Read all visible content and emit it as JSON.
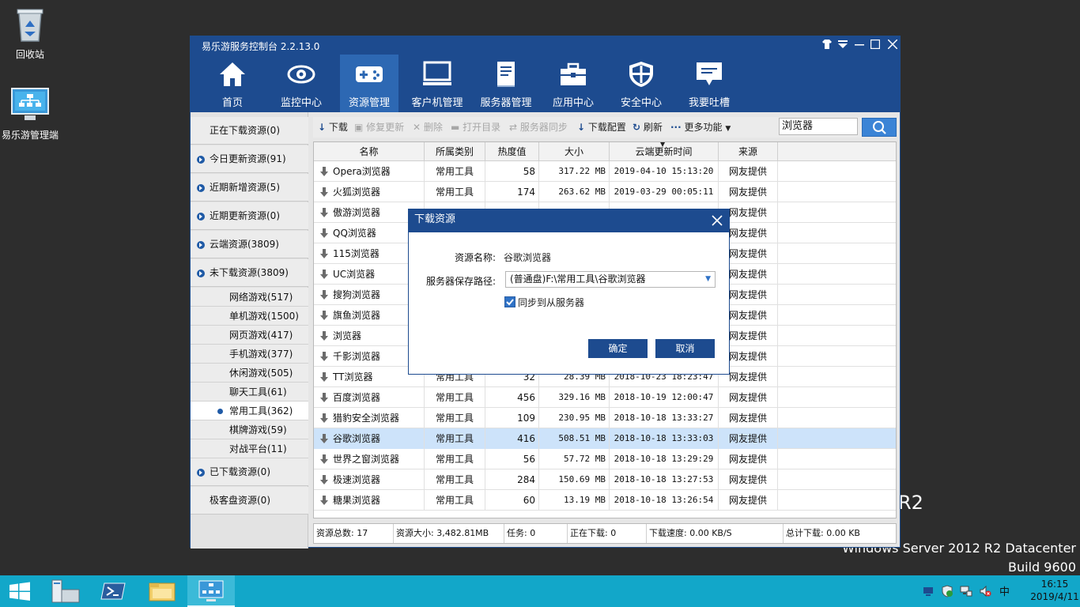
{
  "desktop": {
    "recycle_bin_label": "回收站",
    "app_icon_label": "易乐游管理端",
    "watermark_big": "R2",
    "watermark_line1": "Windows Server 2012 R2 Datacenter",
    "watermark_line2": "Build 9600"
  },
  "window": {
    "title": "易乐游服务控制台 2.2.13.0",
    "nav": [
      {
        "label": "首页",
        "icon": "home-icon"
      },
      {
        "label": "监控中心",
        "icon": "eye-icon"
      },
      {
        "label": "资源管理",
        "icon": "gamepad-icon"
      },
      {
        "label": "客户机管理",
        "icon": "monitor-icon"
      },
      {
        "label": "服务器管理",
        "icon": "document-icon"
      },
      {
        "label": "应用中心",
        "icon": "toolbox-icon"
      },
      {
        "label": "安全中心",
        "icon": "shield-icon"
      },
      {
        "label": "我要吐槽",
        "icon": "feedback-icon"
      }
    ],
    "active_nav": "资源管理"
  },
  "sidebar": {
    "items": [
      {
        "label": "正在下载资源(0)"
      },
      {
        "label": "今日更新资源(91)"
      },
      {
        "label": "近期新增资源(5)"
      },
      {
        "label": "近期更新资源(0)"
      },
      {
        "label": "云端资源(3809)"
      },
      {
        "label": "未下载资源(3809)"
      }
    ],
    "sub": [
      {
        "label": "网络游戏(517)"
      },
      {
        "label": "单机游戏(1500)"
      },
      {
        "label": "网页游戏(417)"
      },
      {
        "label": "手机游戏(377)"
      },
      {
        "label": "休闲游戏(505)"
      },
      {
        "label": "聊天工具(61)"
      },
      {
        "label": "常用工具(362)"
      },
      {
        "label": "棋牌游戏(59)"
      },
      {
        "label": "对战平台(11)"
      }
    ],
    "bottom": [
      {
        "label": "已下载资源(0)"
      },
      {
        "label": "极客盘资源(0)"
      }
    ]
  },
  "toolbar": {
    "download": "下载",
    "repair": "修复更新",
    "delete": "删除",
    "open_dir": "打开目录",
    "server_sync": "服务器同步",
    "download_config": "下载配置",
    "refresh": "刷新",
    "more": "更多功能",
    "search_value": "浏览器"
  },
  "table": {
    "headers": [
      "名称",
      "所属类别",
      "热度值",
      "大小",
      "云端更新时间",
      "来源"
    ],
    "rows": [
      {
        "name": "Opera浏览器",
        "cat": "常用工具",
        "hot": "58",
        "size": "317.22 MB",
        "time": "2019-04-10 15:13:20",
        "src": "网友提供"
      },
      {
        "name": "火狐浏览器",
        "cat": "常用工具",
        "hot": "174",
        "size": "263.62 MB",
        "time": "2019-03-29 00:05:11",
        "src": "网友提供"
      },
      {
        "name": "傲游浏览器",
        "cat": "",
        "hot": "",
        "size": "",
        "time": "",
        "src": "网友提供"
      },
      {
        "name": "QQ浏览器",
        "cat": "",
        "hot": "",
        "size": "",
        "time": "",
        "src": "网友提供"
      },
      {
        "name": "115浏览器",
        "cat": "",
        "hot": "",
        "size": "",
        "time": "",
        "src": "网友提供"
      },
      {
        "name": "UC浏览器",
        "cat": "",
        "hot": "",
        "size": "",
        "time": "",
        "src": "网友提供"
      },
      {
        "name": "搜狗浏览器",
        "cat": "",
        "hot": "",
        "size": "",
        "time": "",
        "src": "网友提供"
      },
      {
        "name": "旗鱼浏览器",
        "cat": "",
        "hot": "",
        "size": "",
        "time": "",
        "src": "网友提供"
      },
      {
        "name": "浏览器",
        "cat": "",
        "hot": "",
        "size": "",
        "time": "",
        "src": "网友提供"
      },
      {
        "name": "千影浏览器",
        "cat": "",
        "hot": "",
        "size": "",
        "time": "",
        "src": "网友提供"
      },
      {
        "name": "TT浏览器",
        "cat": "常用工具",
        "hot": "32",
        "size": "28.39 MB",
        "time": "2018-10-23 18:23:47",
        "src": "网友提供"
      },
      {
        "name": "百度浏览器",
        "cat": "常用工具",
        "hot": "456",
        "size": "329.16 MB",
        "time": "2018-10-19 12:00:47",
        "src": "网友提供"
      },
      {
        "name": "猎豹安全浏览器",
        "cat": "常用工具",
        "hot": "109",
        "size": "230.95 MB",
        "time": "2018-10-18 13:33:27",
        "src": "网友提供"
      },
      {
        "name": "谷歌浏览器",
        "cat": "常用工具",
        "hot": "416",
        "size": "508.51 MB",
        "time": "2018-10-18 13:33:03",
        "src": "网友提供"
      },
      {
        "name": "世界之窗浏览器",
        "cat": "常用工具",
        "hot": "56",
        "size": "57.72 MB",
        "time": "2018-10-18 13:29:29",
        "src": "网友提供"
      },
      {
        "name": "极速浏览器",
        "cat": "常用工具",
        "hot": "284",
        "size": "150.69 MB",
        "time": "2018-10-18 13:27:53",
        "src": "网友提供"
      },
      {
        "name": "糖果浏览器",
        "cat": "常用工具",
        "hot": "60",
        "size": "13.19 MB",
        "time": "2018-10-18 13:26:54",
        "src": "网友提供"
      }
    ]
  },
  "status": {
    "total": "资源总数: 17",
    "size": "资源大小: 3,482.81MB",
    "tasks": "任务: 0",
    "downloading": "正在下载: 0",
    "speed": "下载速度: 0.00 KB/S",
    "total_download": "总计下载: 0.00 KB"
  },
  "dialog": {
    "title": "下载资源",
    "name_label": "资源名称:",
    "name_value": "谷歌浏览器",
    "path_label": "服务器保存路径:",
    "path_value": "(普通盘)F:\\常用工具\\谷歌浏览器",
    "sync_label": "同步到从服务器",
    "sync_checked": true,
    "ok": "确定",
    "cancel": "取消"
  },
  "taskbar": {
    "time": "16:15",
    "date": "2019/4/11",
    "ime": "中"
  }
}
